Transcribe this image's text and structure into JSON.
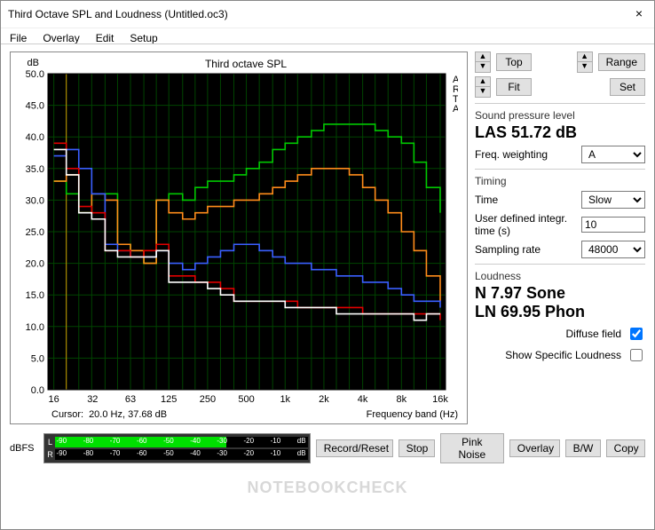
{
  "window": {
    "title": "Third Octave SPL and Loudness (Untitled.oc3)",
    "close_glyph": "×"
  },
  "menu": {
    "file": "File",
    "overlay": "Overlay",
    "edit": "Edit",
    "setup": "Setup"
  },
  "chart": {
    "title": "Third octave SPL",
    "ylabel": "dB",
    "xlabel": "Frequency band (Hz)",
    "cursor_label": "Cursor:",
    "cursor_value": "20.0 Hz, 37.68 dB",
    "arta_label": "A R T A"
  },
  "side": {
    "top_btn": "Top",
    "fit_btn": "Fit",
    "range_btn": "Range",
    "set_btn": "Set",
    "spl_label": "Sound pressure level",
    "spl_value": "LAS 51.72 dB",
    "weighting_label": "Freq. weighting",
    "weighting_value": "A",
    "timing_label": "Timing",
    "time_label": "Time",
    "time_value": "Slow",
    "integ_label": "User defined integr. time (s)",
    "integ_value": "10",
    "sampling_label": "Sampling rate",
    "sampling_value": "48000",
    "loudness_label": "Loudness",
    "loudness_n": "N 7.97 Sone",
    "loudness_ln": "LN 69.95 Phon",
    "diffuse_label": "Diffuse field",
    "specific_label": "Show Specific Loudness"
  },
  "bottom": {
    "dbfs_label": "dBFS",
    "chan_l": "L",
    "chan_r": "R",
    "ticks": [
      "-90",
      "-80",
      "-70",
      "-60",
      "-50",
      "-40",
      "-30",
      "-20",
      "-10",
      "dB"
    ],
    "record": "Record/Reset",
    "stop": "Stop",
    "pink": "Pink Noise",
    "overlay": "Overlay",
    "bw": "B/W",
    "copy": "Copy"
  },
  "watermark": "NOTEBOOKCHECK",
  "chart_data": {
    "type": "line",
    "title": "Third octave SPL",
    "xlabel": "Frequency band (Hz)",
    "ylabel": "dB",
    "ylim": [
      0,
      50
    ],
    "x_scale": "log",
    "x_ticks": [
      16,
      32,
      63,
      125,
      250,
      500,
      1000,
      2000,
      4000,
      8000,
      16000
    ],
    "x_tick_labels": [
      "16",
      "32",
      "63",
      "125",
      "250",
      "500",
      "1k",
      "2k",
      "4k",
      "8k",
      "16k"
    ],
    "categories": [
      16,
      20,
      25,
      31.5,
      40,
      50,
      63,
      80,
      100,
      125,
      160,
      200,
      250,
      315,
      400,
      500,
      630,
      800,
      1000,
      1250,
      1600,
      2000,
      2500,
      3150,
      4000,
      5000,
      6300,
      8000,
      10000,
      12500,
      16000
    ],
    "series": [
      {
        "name": "green",
        "color": "#00c800",
        "values": [
          33,
          31,
          28,
          31,
          31,
          23,
          21,
          20,
          30,
          31,
          30,
          32,
          33,
          33,
          34,
          35,
          36,
          38,
          39,
          40,
          41,
          42,
          42,
          42,
          42,
          41,
          40,
          39,
          36,
          32,
          28
        ]
      },
      {
        "name": "orange",
        "color": "#ff8c1a",
        "values": [
          33,
          34,
          28,
          31,
          30,
          23,
          22,
          20,
          30,
          28,
          27,
          28,
          29,
          29,
          30,
          30,
          31,
          32,
          33,
          34,
          35,
          35,
          35,
          34,
          32,
          30,
          28,
          25,
          22,
          18,
          14
        ]
      },
      {
        "name": "blue",
        "color": "#3a5fff",
        "values": [
          37,
          38,
          35,
          31,
          23,
          22,
          21,
          21,
          22,
          20,
          19,
          20,
          21,
          22,
          23,
          23,
          22,
          21,
          20,
          20,
          19,
          19,
          18,
          18,
          17,
          17,
          16,
          15,
          14,
          14,
          13
        ]
      },
      {
        "name": "red",
        "color": "#e00000",
        "values": [
          39,
          35,
          29,
          28,
          22,
          22,
          21,
          22,
          23,
          18,
          18,
          17,
          17,
          16,
          14,
          14,
          14,
          14,
          14,
          13,
          13,
          13,
          13,
          13,
          12,
          12,
          12,
          12,
          12,
          12,
          11
        ]
      },
      {
        "name": "white",
        "color": "#ffffff",
        "values": [
          38,
          34,
          28,
          27,
          22,
          21,
          21,
          21,
          22,
          17,
          17,
          17,
          16,
          15,
          14,
          14,
          14,
          14,
          13,
          13,
          13,
          13,
          12,
          12,
          12,
          12,
          12,
          12,
          11,
          12,
          12
        ]
      }
    ],
    "cursor": {
      "x": 20.0,
      "y": 37.68
    }
  }
}
